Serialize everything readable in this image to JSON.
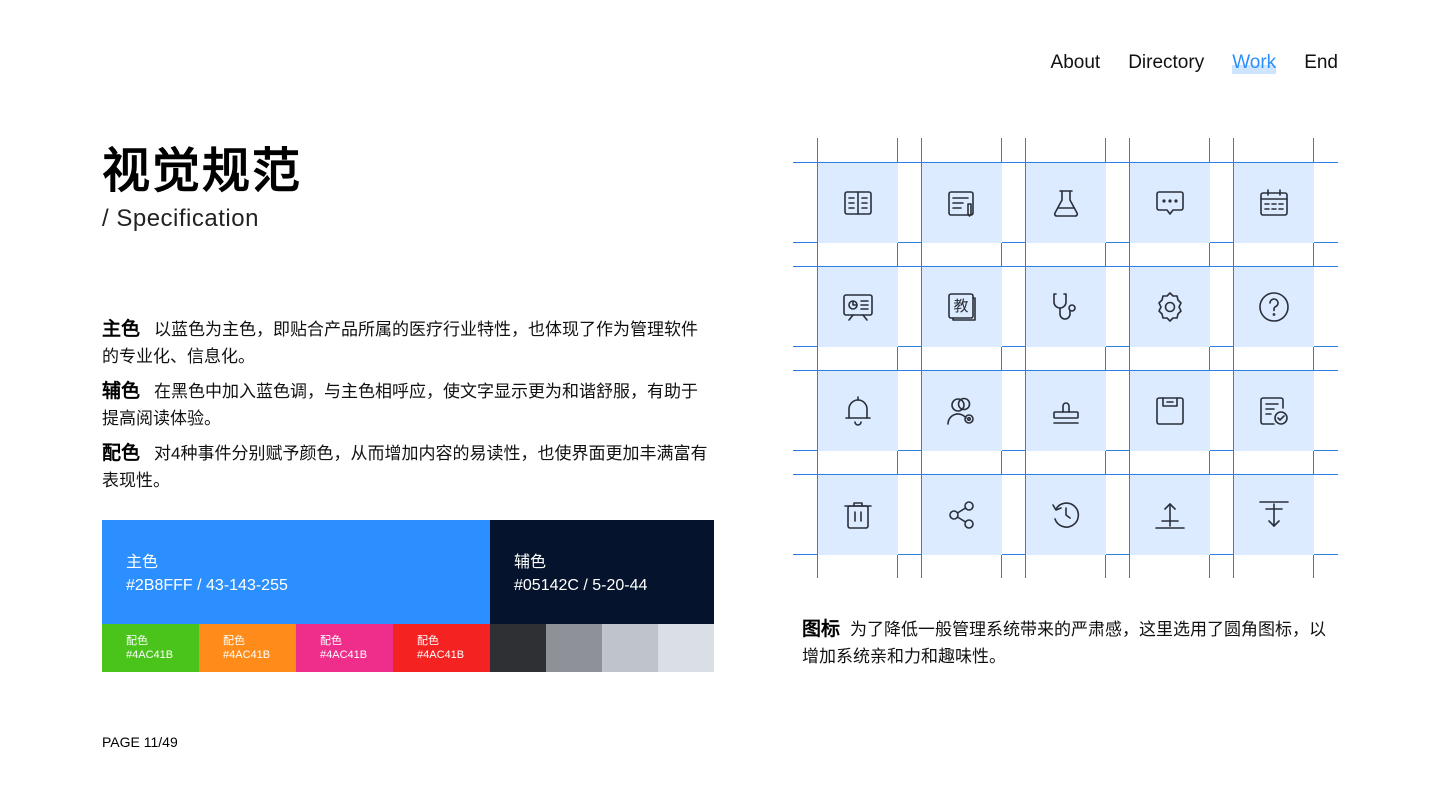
{
  "nav": {
    "items": [
      "About",
      "Directory",
      "Work",
      "End"
    ],
    "active": "Work"
  },
  "title": "视觉规范",
  "subtitle": "/  Specification",
  "paragraphs": [
    {
      "label": "主色",
      "text": "以蓝色为主色，即贴合产品所属的医疗行业特性，也体现了作为管理软件的专业化、信息化。"
    },
    {
      "label": "辅色",
      "text": "在黑色中加入蓝色调，与主色相呼应，使文字显示更为和谐舒服，有助于提高阅读体验。"
    },
    {
      "label": "配色",
      "text": "对4种事件分别赋予颜色，从而增加内容的易读性，也使界面更加丰满富有表现性。"
    }
  ],
  "colors": {
    "main": {
      "label": "主色",
      "code": "#2B8FFF / 43-143-255",
      "hex": "#2B8FFF"
    },
    "sub": {
      "label": "辅色",
      "code": "#05142C / 5-20-44",
      "hex": "#05142C"
    },
    "accents": [
      {
        "label": "配色",
        "code": "#4AC41B",
        "hex": "#4AC41B"
      },
      {
        "label": "配色",
        "code": "#4AC41B",
        "hex": "#FF8C1A"
      },
      {
        "label": "配色",
        "code": "#4AC41B",
        "hex": "#EE2E8A"
      },
      {
        "label": "配色",
        "code": "#4AC41B",
        "hex": "#F52222"
      }
    ],
    "grays": [
      "#2E3033",
      "#8E9197",
      "#BFC4CC",
      "#DADFE6"
    ]
  },
  "page": "PAGE 11/49",
  "icons": [
    "book-icon",
    "document-edit-icon",
    "flask-icon",
    "chat-icon",
    "calendar-icon",
    "presentation-icon",
    "teach-icon",
    "stethoscope-icon",
    "gear-icon",
    "help-icon",
    "bell-icon",
    "user-group-settings-icon",
    "stamp-icon",
    "save-icon",
    "checklist-icon",
    "trash-icon",
    "share-icon",
    "refresh-icon",
    "upload-icon",
    "download-icon"
  ],
  "icon_text": "教",
  "icon_desc": {
    "label": "图标",
    "text": "为了降低一般管理系统带来的严肃感，这里选用了圆角图标，以增加系统亲和力和趣味性。"
  }
}
